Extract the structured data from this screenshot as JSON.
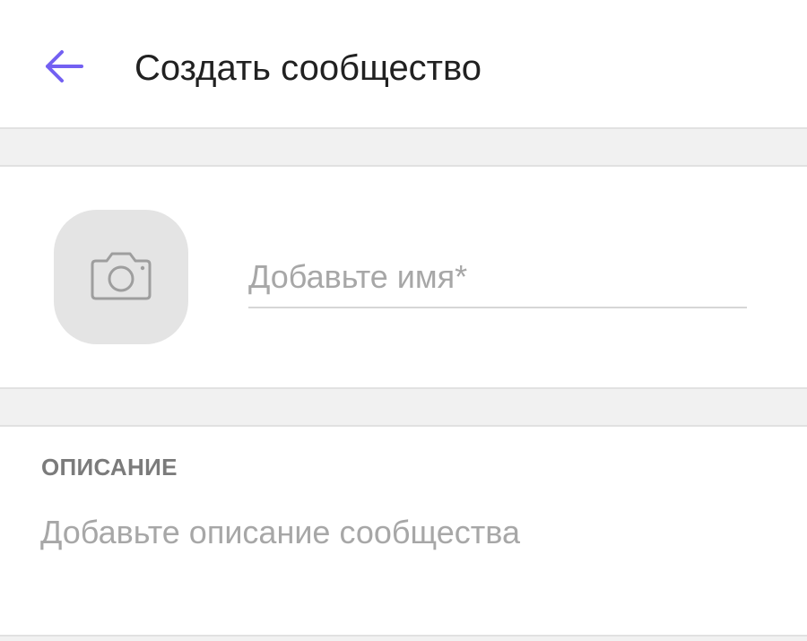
{
  "header": {
    "back_icon": "arrow-left-icon",
    "title": "Создать сообщество"
  },
  "name_section": {
    "avatar_icon": "camera-icon",
    "name_placeholder": "Добавьте имя*",
    "name_value": ""
  },
  "description_section": {
    "heading": "ОПИСАНИЕ",
    "placeholder": "Добавьте описание сообщества",
    "value": ""
  },
  "colors": {
    "accent": "#7360f2",
    "background": "#ffffff",
    "separator": "#f1f1f1",
    "avatar_bg": "#e4e4e4",
    "placeholder": "#a7a7a7",
    "title_text": "#212121",
    "heading_text": "#7b7b7b"
  }
}
